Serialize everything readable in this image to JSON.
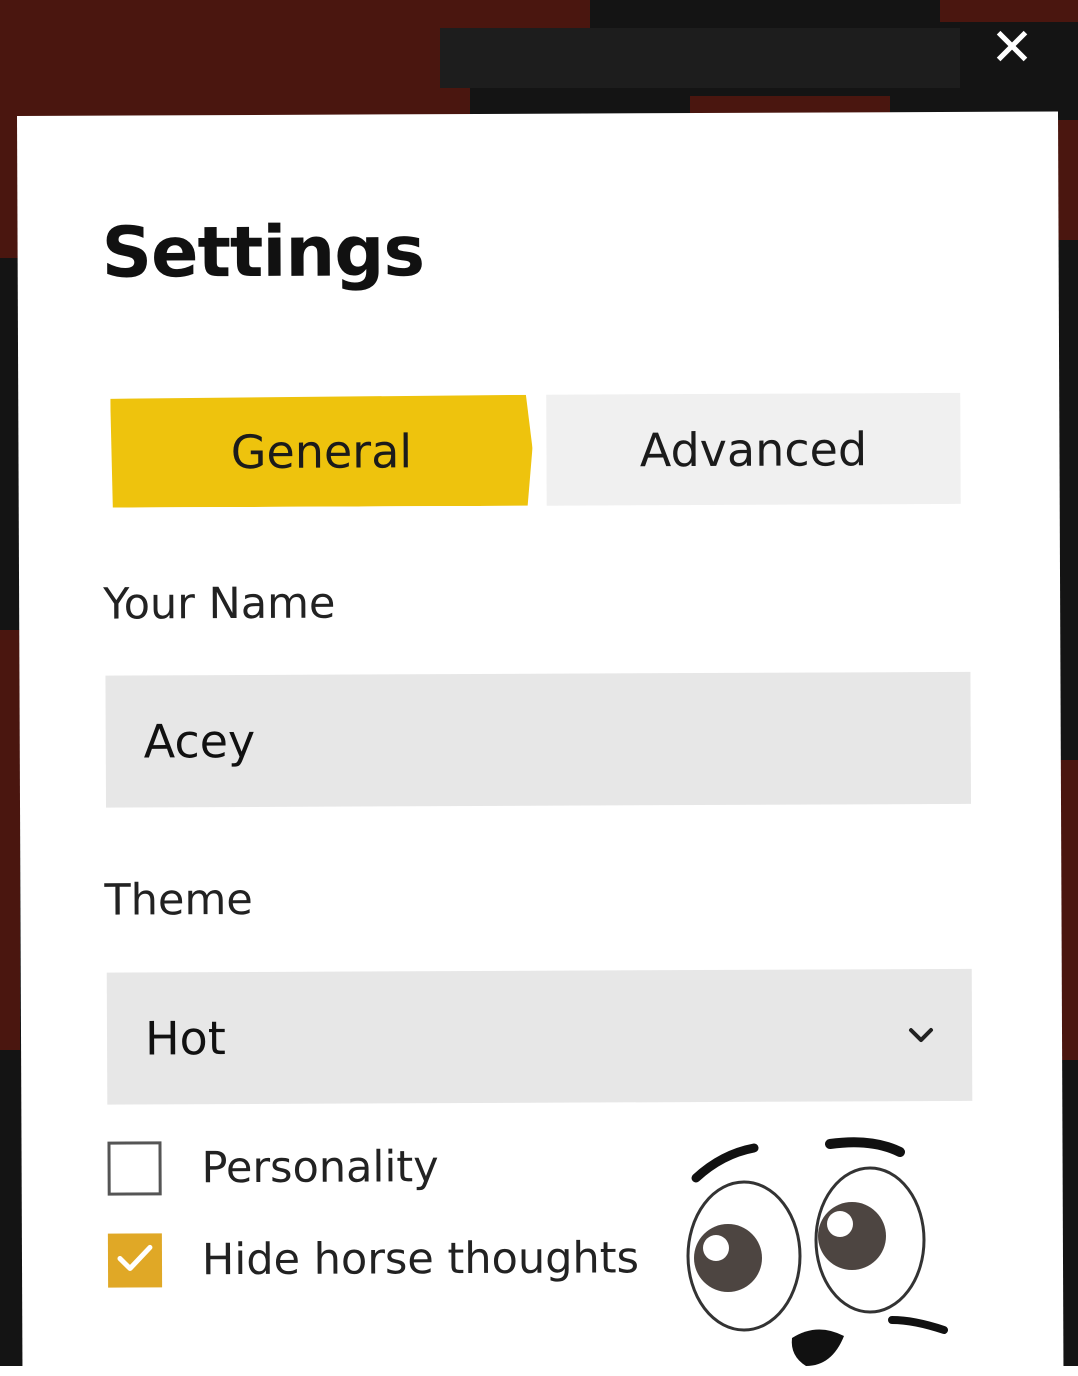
{
  "dialog": {
    "title": "Settings",
    "close_glyph": "✕"
  },
  "tabs": [
    {
      "label": "General",
      "active": true
    },
    {
      "label": "Advanced",
      "active": false
    }
  ],
  "name_field": {
    "label": "Your Name",
    "value": "Acey"
  },
  "theme_field": {
    "label": "Theme",
    "selected": "Hot"
  },
  "options": [
    {
      "label": "Personality",
      "checked": false
    },
    {
      "label": "Hide horse thoughts",
      "checked": true
    }
  ],
  "colors": {
    "active_tab": "#eec30d",
    "checkbox_checked": "#e0a826",
    "input_bg": "#e7e7e7",
    "backdrop_red": "#4a160f"
  }
}
